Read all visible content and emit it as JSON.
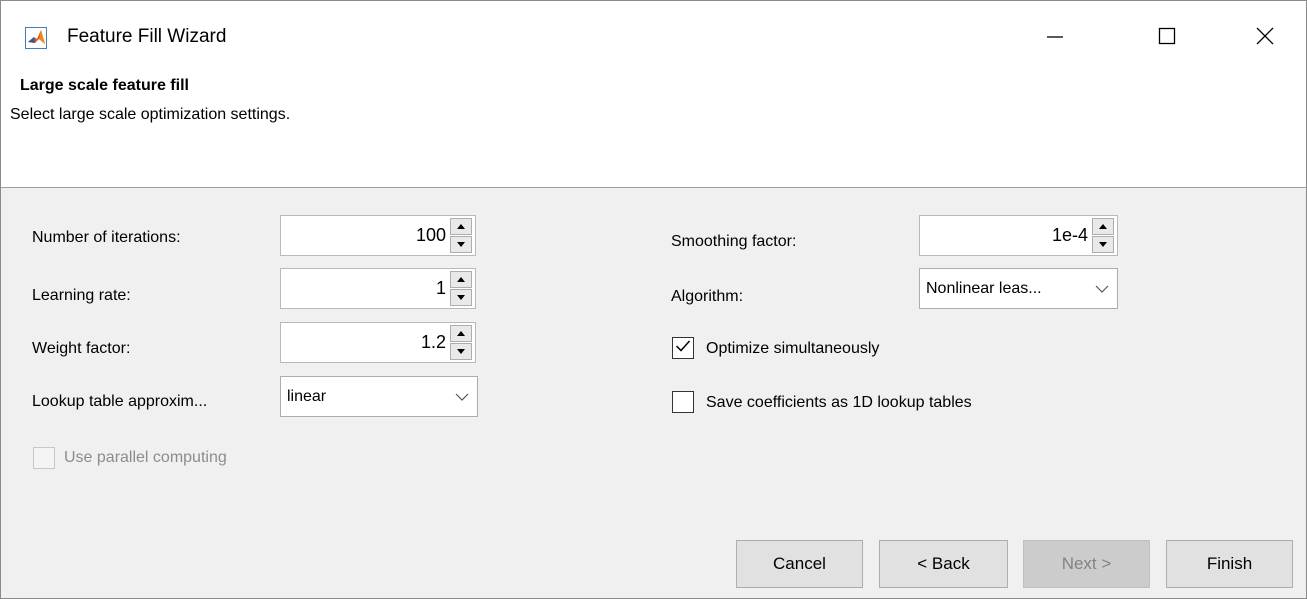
{
  "window": {
    "title": "Feature Fill Wizard",
    "app_icon": "matlab-icon"
  },
  "header": {
    "title": "Large scale feature fill",
    "subtitle": "Select large scale optimization settings."
  },
  "left": {
    "iterations_label": "Number of iterations:",
    "iterations_value": "100",
    "learning_label": "Learning rate:",
    "learning_value": "1",
    "weight_label": "Weight factor:",
    "weight_value": "1.2",
    "lookup_label": "Lookup table approxim...",
    "lookup_value": "linear",
    "parallel_label": "Use parallel computing",
    "parallel_checked": false,
    "parallel_enabled": false
  },
  "right": {
    "smoothing_label": "Smoothing factor:",
    "smoothing_value": "1e-4",
    "algorithm_label": "Algorithm:",
    "algorithm_value": "Nonlinear leas...",
    "optimize_label": "Optimize simultaneously",
    "optimize_checked": true,
    "save_label": "Save coefficients as 1D lookup tables",
    "save_checked": false
  },
  "buttons": {
    "cancel": "Cancel",
    "back": "< Back",
    "next": "Next >",
    "finish": "Finish"
  }
}
